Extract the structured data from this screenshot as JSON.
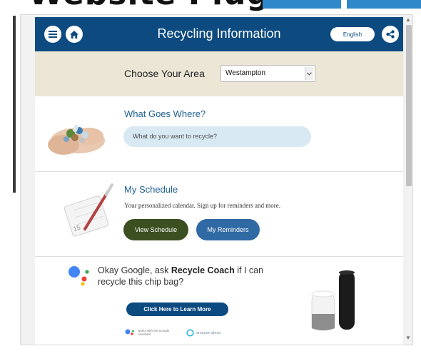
{
  "page": {
    "heading": "Website Plug-in"
  },
  "app": {
    "title": "Recycling Information",
    "language": "English",
    "colors": {
      "header": "#0c4a80",
      "area_band": "#ebe6d6",
      "schedule_button": "#3b4f20",
      "reminders_button": "#2f6aa4"
    }
  },
  "area": {
    "label": "Choose Your Area",
    "selected": "Westampton"
  },
  "what_goes_where": {
    "title": "What Goes Where?",
    "placeholder": "What do you want to recycle?"
  },
  "schedule": {
    "title": "My Schedule",
    "description": "Your personalized calendar. Sign up for reminders and more.",
    "view_button": "View Schedule",
    "reminders_button": "My Reminders"
  },
  "google": {
    "prompt_prefix": "Okay Google, ask ",
    "prompt_brand": "Recycle Coach",
    "prompt_suffix": " if I can recycle this chip bag?",
    "learn_button": "Click Here to Learn More",
    "works_with": "works with the Google Assistant",
    "alexa": "amazon alexa"
  },
  "icons": [
    "menu-icon",
    "home-icon",
    "share-icon",
    "chevron-down-icon",
    "google-assistant-logo-icon",
    "alexa-ring-icon"
  ]
}
